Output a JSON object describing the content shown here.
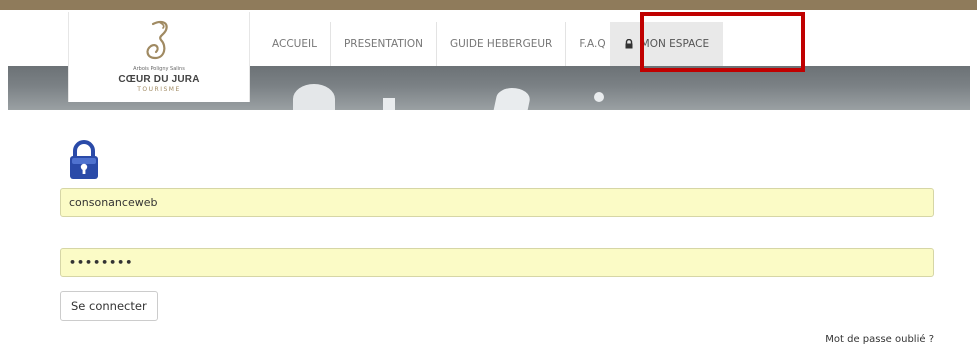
{
  "logo": {
    "small_text": "Arbois Poligny Salins",
    "title": "CŒUR DU JURA",
    "subtitle": "TOURISME",
    "icon": "swirl-logo-icon"
  },
  "nav": {
    "items": [
      {
        "label": "ACCUEIL"
      },
      {
        "label": "PRESENTATION"
      },
      {
        "label": "GUIDE HEBERGEUR"
      },
      {
        "label": "F.A.Q"
      },
      {
        "label": "MON ESPACE",
        "icon": "lock-icon"
      }
    ]
  },
  "login": {
    "icon": "padlock-icon",
    "username_value": "consonanceweb",
    "password_value": "••••••••",
    "submit_label": "Se connecter",
    "forgot_label": "Mot de passe oublié ?"
  },
  "colors": {
    "top_bar": "#8f7b5b",
    "input_bg": "#fbfbc6",
    "highlight": "#c00000",
    "padlock": "#2a4aa8"
  }
}
